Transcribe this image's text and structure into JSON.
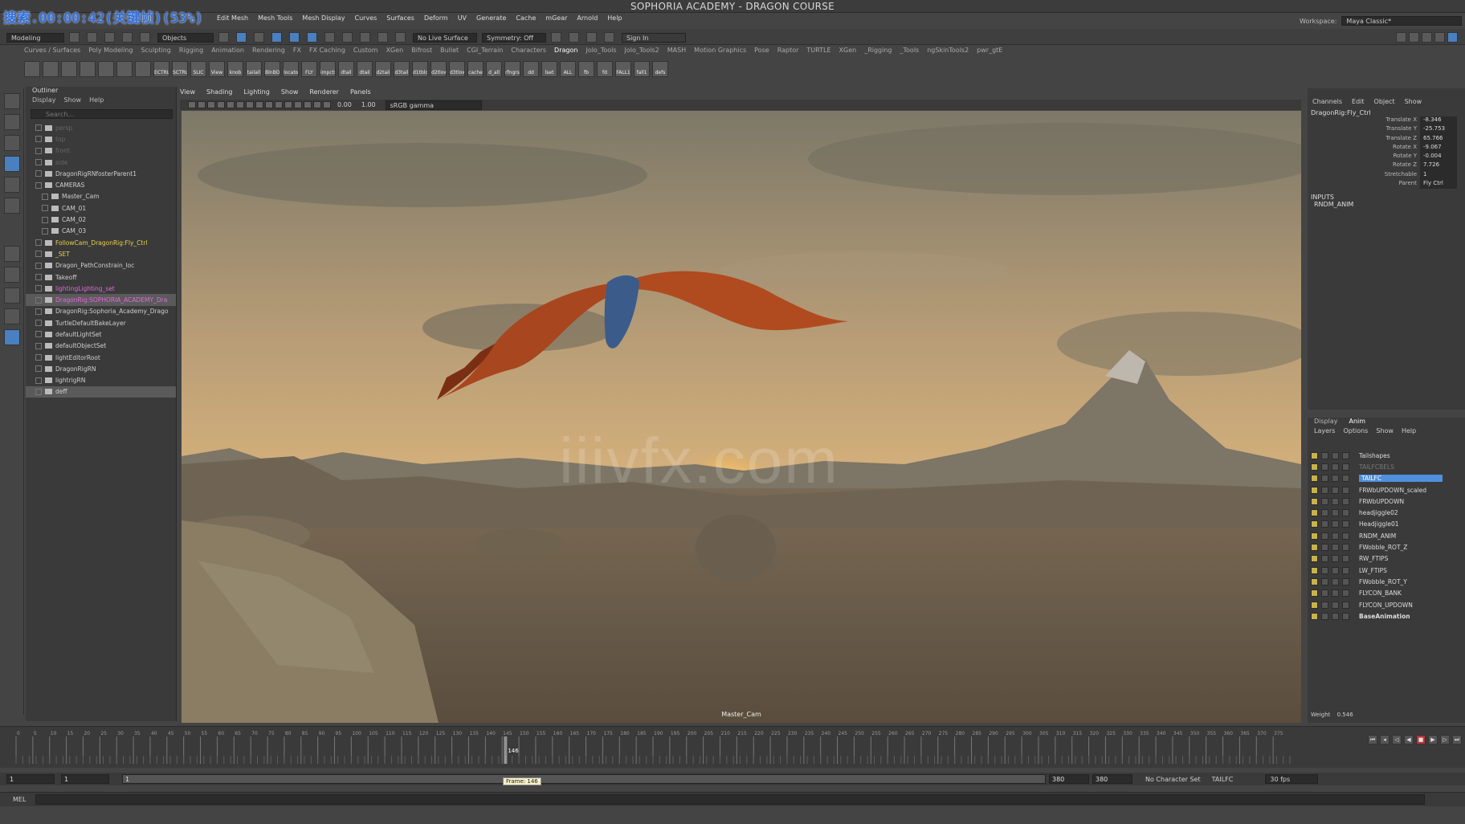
{
  "title": "SOPHORIA ACADEMY - DRAGON COURSE",
  "recording_overlay": "搜索.00:00:42(关键帧)(53%)",
  "menubar": [
    "Edit Mesh",
    "Mesh Tools",
    "Mesh Display",
    "Curves",
    "Surfaces",
    "Deform",
    "UV",
    "Generate",
    "Cache",
    "mGear",
    "Arnold",
    "Help"
  ],
  "workspace": {
    "label": "Workspace:",
    "value": "Maya Classic*"
  },
  "statusline": {
    "mode": "Modeling",
    "objects": "Objects",
    "live": "No Live Surface",
    "symmetry": "Symmetry: Off",
    "signin": "Sign In"
  },
  "shelf_tabs": [
    "Curves / Surfaces",
    "Poly Modeling",
    "Sculpting",
    "Rigging",
    "Animation",
    "Rendering",
    "FX",
    "FX Caching",
    "Custom",
    "XGen",
    "Bifrost",
    "Bullet",
    "CGI_Terrain",
    "Characters",
    "Dragon",
    "Jolo_Tools",
    "Jolo_Tools2",
    "MASH",
    "Motion Graphics",
    "Pose",
    "Raptor",
    "TURTLE",
    "XGen",
    "_Rigging",
    "_Tools",
    "ngSkinTools2",
    "pwr_gtE"
  ],
  "shelf_active": "Dragon",
  "shelf_buttons": [
    "",
    "",
    "",
    "",
    "",
    "",
    "",
    "ECTRL",
    "SCTRLS",
    "SLIC",
    "View",
    "knob",
    "tailall",
    "BlnBD",
    "locator",
    "FLY",
    "impcts",
    "dtail",
    "dtail",
    "d2tail",
    "d3tail",
    "d1tbloc",
    "d2tlow",
    "d3tlow",
    "cache",
    "d_all",
    "rfngrs",
    "dd",
    "lset",
    "ALL",
    "fb",
    "fd",
    "FALL1",
    "fall1",
    "defs"
  ],
  "outliner": {
    "title": "Outliner",
    "menu": [
      "Display",
      "Show",
      "Help"
    ],
    "search_placeholder": "Search...",
    "rows": [
      {
        "label": "persp",
        "style": "dim"
      },
      {
        "label": "top",
        "style": "dim"
      },
      {
        "label": "front",
        "style": "dim"
      },
      {
        "label": "side",
        "style": "dim"
      },
      {
        "label": "DragonRigRNfosterParent1",
        "style": ""
      },
      {
        "label": "CAMERAS",
        "style": ""
      },
      {
        "label": "Master_Cam",
        "style": ""
      },
      {
        "label": "CAM_01",
        "style": ""
      },
      {
        "label": "CAM_02",
        "style": ""
      },
      {
        "label": "CAM_03",
        "style": ""
      },
      {
        "label": "FollowCam_DragonRig:Fly_Ctrl",
        "style": "yel"
      },
      {
        "label": "_SET",
        "style": "yel"
      },
      {
        "label": "Dragon_PathConstrain_loc",
        "style": ""
      },
      {
        "label": "Takeoff",
        "style": ""
      },
      {
        "label": "lightingLighting_set",
        "style": "pink"
      },
      {
        "label": "DragonRig:SOPHORIA_ACADEMY_Dra",
        "style": "pinksel"
      },
      {
        "label": "DragonRig:Sophoria_Academy_Drago",
        "style": ""
      },
      {
        "label": "TurtleDefaultBakeLayer",
        "style": ""
      },
      {
        "label": "defaultLightSet",
        "style": ""
      },
      {
        "label": "defaultObjectSet",
        "style": ""
      },
      {
        "label": "lightEditorRoot",
        "style": ""
      },
      {
        "label": "DragonRigRN",
        "style": ""
      },
      {
        "label": "lightrigRN",
        "style": ""
      },
      {
        "label": "deff",
        "style": "sel"
      }
    ]
  },
  "viewport": {
    "menu": [
      "View",
      "Shading",
      "Lighting",
      "Show",
      "Renderer",
      "Panels"
    ],
    "camera": "Master_Cam",
    "watermark": "iiivfx.com",
    "exposure": "0.00",
    "gamma": "1.00",
    "colorspace": "sRGB gamma"
  },
  "channelbox": {
    "menu": [
      "Channels",
      "Edit",
      "Object",
      "Show"
    ],
    "object": "DragonRig:Fly_Ctrl",
    "attrs": [
      {
        "name": "Translate X",
        "value": "-8.346"
      },
      {
        "name": "Translate Y",
        "value": "-25.753"
      },
      {
        "name": "Translate Z",
        "value": "65.766"
      },
      {
        "name": "Rotate X",
        "value": "-9.067"
      },
      {
        "name": "Rotate Y",
        "value": "-0.004"
      },
      {
        "name": "Rotate Z",
        "value": "7.726"
      },
      {
        "name": "Stretchable",
        "value": "1"
      },
      {
        "name": "Parent",
        "value": "Fly Ctrl"
      }
    ],
    "inputs_label": "INPUTS",
    "input_item": "RNDM_ANIM"
  },
  "layers": {
    "tabs": [
      "Display",
      "Anim"
    ],
    "active_tab": "Anim",
    "menu": [
      "Layers",
      "Options",
      "Show",
      "Help"
    ],
    "rows": [
      {
        "name": "Tailshapes",
        "state": ""
      },
      {
        "name": "TAILFCBELS",
        "state": "dim"
      },
      {
        "name": "TAILFC",
        "state": "sel"
      },
      {
        "name": "FRWbUPDOWN_scaled",
        "state": ""
      },
      {
        "name": "FRWbUPDOWN",
        "state": ""
      },
      {
        "name": "headjiggle02",
        "state": ""
      },
      {
        "name": "Headjiggle01",
        "state": ""
      },
      {
        "name": "RNDM_ANIM",
        "state": ""
      },
      {
        "name": "FWobble_ROT_Z",
        "state": ""
      },
      {
        "name": "RW_FTIPS",
        "state": ""
      },
      {
        "name": "LW_FTIPS",
        "state": ""
      },
      {
        "name": "FWobble_ROT_Y",
        "state": ""
      },
      {
        "name": "FLYCON_BANK",
        "state": ""
      },
      {
        "name": "FLYCON_UPDOWN",
        "state": ""
      },
      {
        "name": "BaseAnimation",
        "state": "bold"
      }
    ],
    "weight_label": "Weight",
    "weight_value": "0.546"
  },
  "timeline": {
    "start": 0,
    "end": 380,
    "current": 146,
    "tick_labels": [
      "0",
      "5",
      "10",
      "15",
      "20",
      "25",
      "30",
      "35",
      "40",
      "45",
      "50",
      "55",
      "60",
      "65",
      "70",
      "75",
      "80",
      "85",
      "90",
      "95",
      "100",
      "105",
      "110",
      "115",
      "120",
      "125",
      "130",
      "135",
      "140",
      "145",
      "150",
      "155",
      "160",
      "165",
      "170",
      "175",
      "180",
      "185",
      "190",
      "195",
      "200",
      "205",
      "210",
      "215",
      "220",
      "225",
      "230",
      "235",
      "240",
      "245",
      "250",
      "255",
      "260",
      "265",
      "270",
      "275",
      "280",
      "285",
      "290",
      "295",
      "300",
      "305",
      "310",
      "315",
      "320",
      "325",
      "330",
      "335",
      "340",
      "345",
      "350",
      "355",
      "360",
      "365",
      "370",
      "375"
    ],
    "current_label": "146",
    "tooltip": "Frame: 146"
  },
  "range": {
    "start": "1",
    "min": "1",
    "anim_start": "1",
    "range_end": "380",
    "anim_end": "380",
    "end": "380",
    "character": "No Character Set",
    "layer": "TAILFC",
    "fps": "30 fps"
  },
  "cmdline": {
    "label": "MEL"
  },
  "colors": {
    "accent": "#4f8fdc",
    "selected_outliner": "#e06adf",
    "overlay": "#2f6fe0"
  }
}
